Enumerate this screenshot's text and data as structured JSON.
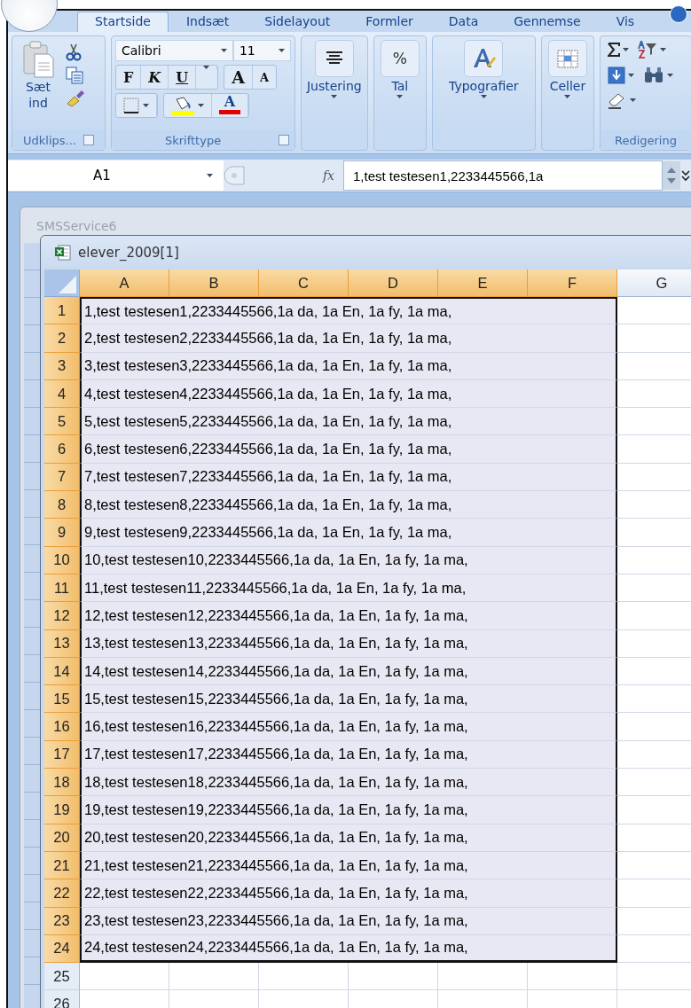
{
  "ribbon_tabs": [
    {
      "label": "Startside",
      "selected": true
    },
    {
      "label": "Indsæt",
      "selected": false
    },
    {
      "label": "Sidelayout",
      "selected": false
    },
    {
      "label": "Formler",
      "selected": false
    },
    {
      "label": "Data",
      "selected": false
    },
    {
      "label": "Gennemse",
      "selected": false
    },
    {
      "label": "Vis",
      "selected": false
    }
  ],
  "clipboard": {
    "title": "Udklips...",
    "paste": "Sæt ind"
  },
  "font": {
    "title": "Skrifttype",
    "family": "Calibri",
    "size": "11",
    "bold": "F",
    "italic": "K",
    "underline": "U",
    "grow": "A",
    "shrink": "A",
    "font_color": "A"
  },
  "large_groups": [
    {
      "kind": "align",
      "label": "Justering"
    },
    {
      "kind": "number",
      "label": "Tal",
      "symbol": "%"
    },
    {
      "kind": "styles",
      "label": "Typografier"
    },
    {
      "kind": "cells",
      "label": "Celler"
    }
  ],
  "editing": {
    "title": "Redigering"
  },
  "formula_bar": {
    "name_box": "A1",
    "function_label": "fx",
    "value": "1,test testesen1,2233445566,1a"
  },
  "background_window": {
    "title": "SMSService6"
  },
  "workbook": {
    "title": "elever_2009[1]",
    "columns": [
      {
        "label": "A",
        "selected": true
      },
      {
        "label": "B",
        "selected": true
      },
      {
        "label": "C",
        "selected": true
      },
      {
        "label": "D",
        "selected": true
      },
      {
        "label": "E",
        "selected": true
      },
      {
        "label": "F",
        "selected": true
      },
      {
        "label": "G",
        "selected": false
      }
    ],
    "rows": [
      {
        "number": "1",
        "text": "1,test testesen1,2233445566,1a da, 1a En, 1a fy, 1a ma,",
        "selected": true
      },
      {
        "number": "2",
        "text": "2,test testesen2,2233445566,1a da, 1a En, 1a fy, 1a ma,",
        "selected": true
      },
      {
        "number": "3",
        "text": "3,test testesen3,2233445566,1a da, 1a En, 1a fy, 1a ma,",
        "selected": true
      },
      {
        "number": "4",
        "text": "4,test testesen4,2233445566,1a da, 1a En, 1a fy, 1a ma,",
        "selected": true
      },
      {
        "number": "5",
        "text": "5,test testesen5,2233445566,1a da, 1a En, 1a fy, 1a ma,",
        "selected": true
      },
      {
        "number": "6",
        "text": "6,test testesen6,2233445566,1a da, 1a En, 1a fy, 1a ma,",
        "selected": true
      },
      {
        "number": "7",
        "text": "7,test testesen7,2233445566,1a da, 1a En, 1a fy, 1a ma,",
        "selected": true
      },
      {
        "number": "8",
        "text": "8,test testesen8,2233445566,1a da, 1a En, 1a fy, 1a ma,",
        "selected": true
      },
      {
        "number": "9",
        "text": "9,test testesen9,2233445566,1a da, 1a En, 1a fy, 1a ma,",
        "selected": true
      },
      {
        "number": "10",
        "text": "10,test testesen10,2233445566,1a da, 1a En, 1a fy, 1a ma,",
        "selected": true
      },
      {
        "number": "11",
        "text": "11,test testesen11,2233445566,1a da, 1a En, 1a fy, 1a ma,",
        "selected": true
      },
      {
        "number": "12",
        "text": "12,test testesen12,2233445566,1a da, 1a En, 1a fy, 1a ma,",
        "selected": true
      },
      {
        "number": "13",
        "text": "13,test testesen13,2233445566,1a da, 1a En, 1a fy, 1a ma,",
        "selected": true
      },
      {
        "number": "14",
        "text": "14,test testesen14,2233445566,1a da, 1a En, 1a fy, 1a ma,",
        "selected": true
      },
      {
        "number": "15",
        "text": "15,test testesen15,2233445566,1a da, 1a En, 1a fy, 1a ma,",
        "selected": true
      },
      {
        "number": "16",
        "text": "16,test testesen16,2233445566,1a da, 1a En, 1a fy, 1a ma,",
        "selected": true
      },
      {
        "number": "17",
        "text": "17,test testesen17,2233445566,1a da, 1a En, 1a fy, 1a ma,",
        "selected": true
      },
      {
        "number": "18",
        "text": "18,test testesen18,2233445566,1a da, 1a En, 1a fy, 1a ma,",
        "selected": true
      },
      {
        "number": "19",
        "text": "19,test testesen19,2233445566,1a da, 1a En, 1a fy, 1a ma,",
        "selected": true
      },
      {
        "number": "20",
        "text": "20,test testesen20,2233445566,1a da, 1a En, 1a fy, 1a ma,",
        "selected": true
      },
      {
        "number": "21",
        "text": "21,test testesen21,2233445566,1a da, 1a En, 1a fy, 1a ma,",
        "selected": true
      },
      {
        "number": "22",
        "text": "22,test testesen22,2233445566,1a da, 1a En, 1a fy, 1a ma,",
        "selected": true
      },
      {
        "number": "23",
        "text": "23,test testesen23,2233445566,1a da, 1a En, 1a fy, 1a ma,",
        "selected": true
      },
      {
        "number": "24",
        "text": "24,test testesen24,2233445566,1a da, 1a En, 1a fy, 1a ma,",
        "selected": true
      },
      {
        "number": "25",
        "selected": false
      },
      {
        "number": "26",
        "selected": false
      }
    ]
  }
}
